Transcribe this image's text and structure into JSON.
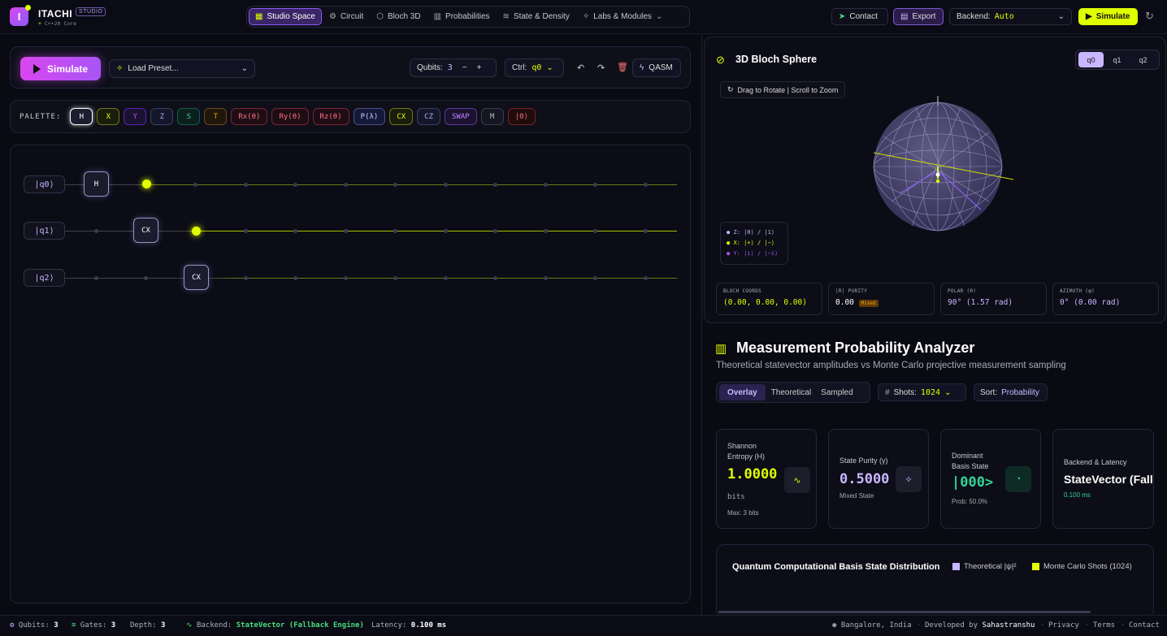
{
  "brand": {
    "name": "ITACHI",
    "tag": "STUDIO",
    "sub_plus": "+",
    "sub_text": "C++20 Core"
  },
  "nav": [
    {
      "label": "Studio Space",
      "icon": "grid-icon"
    },
    {
      "label": "Circuit",
      "icon": "circuit-icon"
    },
    {
      "label": "Bloch 3D",
      "icon": "sphere-icon"
    },
    {
      "label": "Probabilities",
      "icon": "bar-chart-icon"
    },
    {
      "label": "State & Density",
      "icon": "layers-icon"
    },
    {
      "label": "Labs & Modules",
      "icon": "sparkle-icon",
      "caret": "⌄"
    }
  ],
  "topright": {
    "contact": "Contact",
    "export": "Export",
    "backend_label": "Backend:",
    "backend_value": "Auto",
    "simulate": "Simulate"
  },
  "toolbar": {
    "simulate": "Simulate",
    "preset": "Load Preset...",
    "qubits_label": "Qubits:",
    "qubits_value": "3",
    "minus": "−",
    "plus": "+",
    "ctrl_label": "Ctrl:",
    "ctrl_value": "q0",
    "qasm": "QASM"
  },
  "palette": {
    "label": "PALETTE:",
    "gates": [
      "H",
      "X",
      "Y",
      "Z",
      "S",
      "T",
      "Rx(θ)",
      "Ry(θ)",
      "Rz(θ)",
      "P(λ)",
      "CX",
      "CZ",
      "SWAP",
      "M",
      "|0⟩"
    ]
  },
  "circuit": {
    "qubits": [
      "|q0⟩",
      "|q1⟩",
      "|q2⟩"
    ],
    "gates": [
      "H",
      "CX",
      "CX"
    ]
  },
  "bloch": {
    "title": "3D Bloch Sphere",
    "hint": "Drag to Rotate | Scroll to Zoom",
    "tabs": [
      "q0",
      "q1",
      "q2"
    ],
    "legend": [
      "Z: |0⟩ / |1⟩",
      "X: |+⟩ / |−⟩",
      "Y: |i⟩ / |−i⟩"
    ],
    "metrics": [
      {
        "label": "BLOCH COORDS",
        "value": "(0.00, 0.00, 0.00)"
      },
      {
        "label": "|R| PURITY",
        "value": "0.00",
        "badge": "Mixed"
      },
      {
        "label": "POLAR (θ)",
        "value": "90° (1.57 rad)"
      },
      {
        "label": "AZIMUTH (φ)",
        "value": "0° (0.00 rad)"
      }
    ]
  },
  "prob": {
    "title": "Measurement Probability Analyzer",
    "subtitle": "Theoretical statevector amplitudes vs Monte Carlo projective measurement sampling",
    "tabs": [
      "Overlay",
      "Theoretical",
      "Sampled"
    ],
    "shots_label": "Shots:",
    "shots_value": "1024",
    "sort_label": "Sort:",
    "sort_value": "Probability",
    "cards": [
      {
        "label1": "Shannon",
        "label2": "Entropy (H)",
        "value": "1.0000",
        "unit": "bits",
        "note": "Max: 3 bits"
      },
      {
        "label1": "State Purity (γ)",
        "value": "0.5000",
        "note": "Mixed State"
      },
      {
        "label1": "Dominant",
        "label2": "Basis State",
        "value": "|000>",
        "note": "Prob: 50.0%"
      },
      {
        "label1": "Backend & Latency",
        "value": "StateVector (Fallback Engine)",
        "note": "0.100 ms"
      }
    ],
    "chart_title": "Quantum Computational Basis State Distribution",
    "legend_theo": "Theoretical |ψ|²",
    "legend_mc": "Monte Carlo Shots (1024)"
  },
  "status": {
    "qubits_label": "Qubits:",
    "qubits": "3",
    "gates_label": "Gates:",
    "gates": "3",
    "depth_label": "Depth:",
    "depth": "3",
    "backend_label": "Backend:",
    "backend": "StateVector (Fallback Engine)",
    "latency_label": "Latency:",
    "latency": "0.100 ms",
    "location": "Bangalore, India",
    "dev_label": "Developed by",
    "dev": "Sahastranshu",
    "links": [
      "Privacy",
      "Terms",
      "Contact"
    ],
    "sep": "·"
  }
}
